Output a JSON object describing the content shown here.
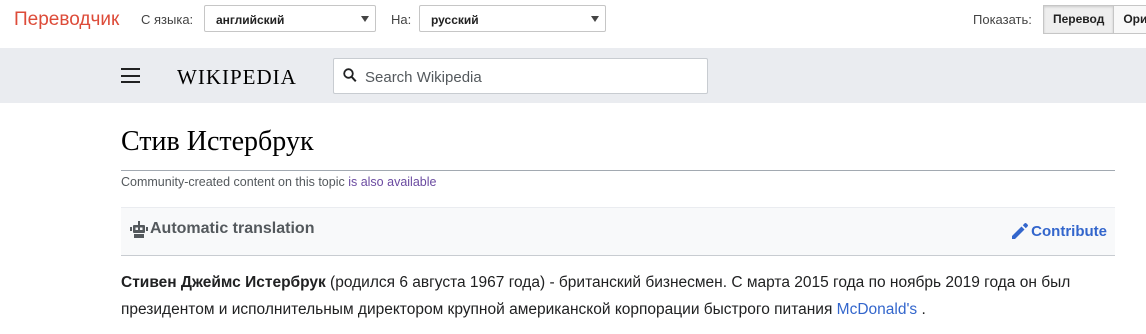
{
  "translate_bar": {
    "brand": "Переводчик",
    "from_label": "С языка:",
    "from_value": "английский",
    "to_label": "На:",
    "to_value": "русский",
    "show_label": "Показать:",
    "show_translation": "Перевод",
    "show_original": "Ори"
  },
  "wiki_header": {
    "logo": "WIKIPEDIA",
    "search_placeholder": "Search Wikipedia"
  },
  "article": {
    "title": "Стив Истербрук",
    "community_prefix": "Community-created content on this topic ",
    "community_is": "is",
    "community_link": " also available",
    "auto_translation": "Automatic translation",
    "contribute": "Contribute",
    "para_bold": "Стивен Джеймс Истербрук",
    "para_text": " (родился 6 августа 1967 года) - британский бизнесмен. С марта 2015 года по ноябрь 2019 года он был президентом и исполнительным директором крупной американской корпорации быстрого питания ",
    "para_link": "McDonald's",
    "para_end": " ."
  },
  "colors": {
    "brand_red": "#dd4b39",
    "link_blue": "#3366cc",
    "header_gray": "#eaecf0"
  },
  "icons": [
    "hamburger-icon",
    "search-icon",
    "robot-icon",
    "pencil-icon",
    "chevron-down-icon"
  ]
}
